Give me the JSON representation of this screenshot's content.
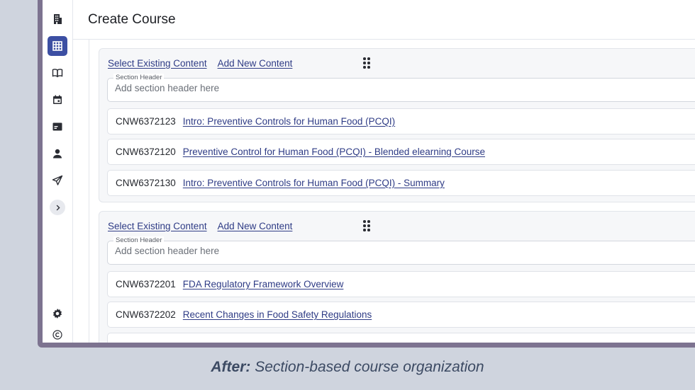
{
  "page": {
    "title": "Create Course"
  },
  "sidebar": {
    "items": [
      {
        "icon": "building-icon"
      },
      {
        "icon": "grid-icon",
        "active": true
      },
      {
        "icon": "book-icon"
      },
      {
        "icon": "calendar-icon"
      },
      {
        "icon": "card-icon"
      },
      {
        "icon": "person-icon"
      },
      {
        "icon": "send-icon"
      }
    ],
    "expand_icon": "chevron-right-icon",
    "bottom": [
      {
        "icon": "gear-icon"
      },
      {
        "icon": "copyright-icon"
      }
    ]
  },
  "section_controls": {
    "select_existing": "Select Existing Content",
    "add_new": "Add New Content",
    "header_label": "Section Header",
    "header_placeholder": "Add section header here"
  },
  "sections": [
    {
      "items": [
        {
          "code": "CNW6372123",
          "title": "Intro: Preventive Controls for Human Food (PCQI)"
        },
        {
          "code": "CNW6372120",
          "title": "Preventive Control for Human Food (PCQI) - Blended elearning Course"
        },
        {
          "code": "CNW6372130",
          "title": "Intro: Preventive Controls for Human Food (PCQI) - Summary"
        }
      ]
    },
    {
      "items": [
        {
          "code": "CNW6372201",
          "title": "FDA Regulatory Framework Overview"
        },
        {
          "code": "CNW6372202",
          "title": "Recent Changes in Food Safety Regulations"
        }
      ]
    }
  ],
  "caption": {
    "prefix": "After:",
    "text": "Section-based course organization"
  },
  "colors": {
    "accent": "#3c4fa3",
    "link": "#2e3b85",
    "frame": "#7d7390",
    "backdrop": "#cfd4de"
  }
}
